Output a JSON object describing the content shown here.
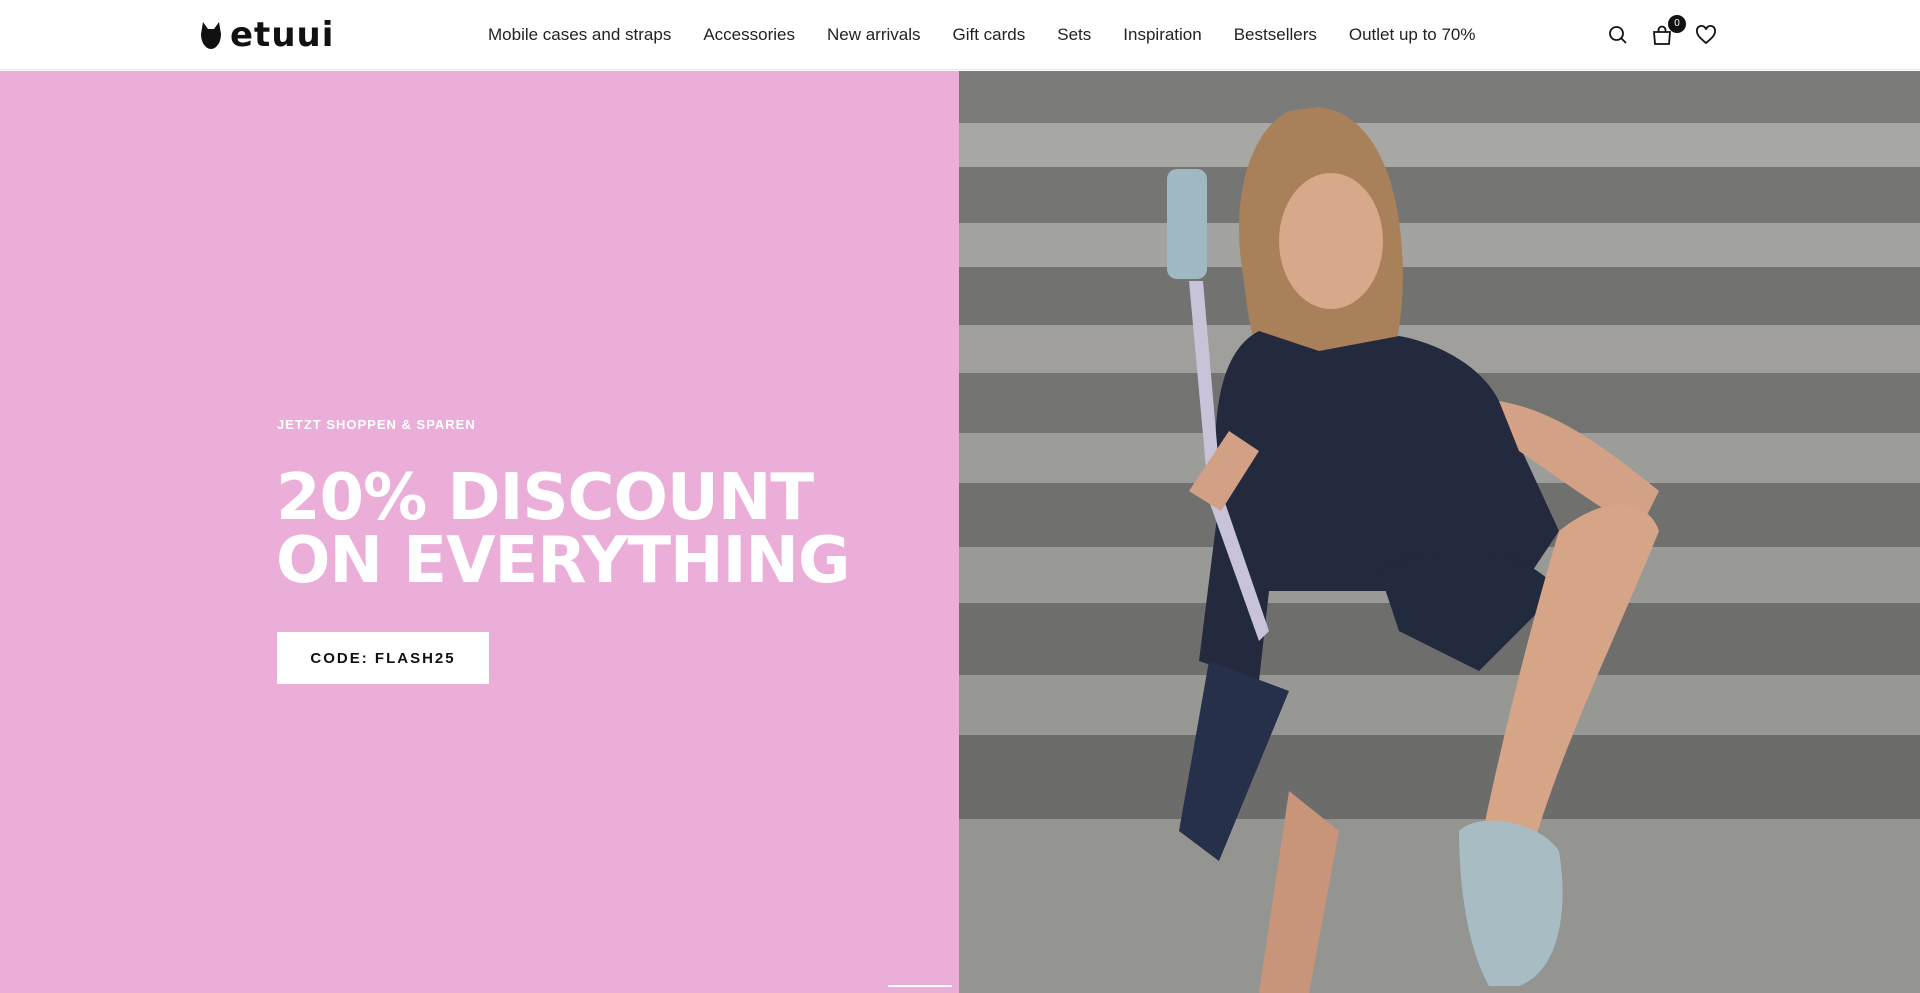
{
  "header": {
    "logo_text": "etuui",
    "nav": [
      {
        "label": "Mobile cases and straps"
      },
      {
        "label": "Accessories"
      },
      {
        "label": "New arrivals"
      },
      {
        "label": "Gift cards"
      },
      {
        "label": "Sets"
      },
      {
        "label": "Inspiration"
      },
      {
        "label": "Bestsellers"
      },
      {
        "label": "Outlet up to 70%"
      }
    ],
    "icons": {
      "search": "search-icon",
      "cart": "shopping-bag-icon",
      "wishlist": "heart-icon"
    },
    "cart_count": "0"
  },
  "hero": {
    "eyebrow": "JETZT SHOPPEN & SPAREN",
    "title": "20% DISCOUNT ON EVERYTHING",
    "code_button": "CODE: FLASH25",
    "background_color": "#ebaed8",
    "slides_total": 2,
    "active_slide": 1
  }
}
